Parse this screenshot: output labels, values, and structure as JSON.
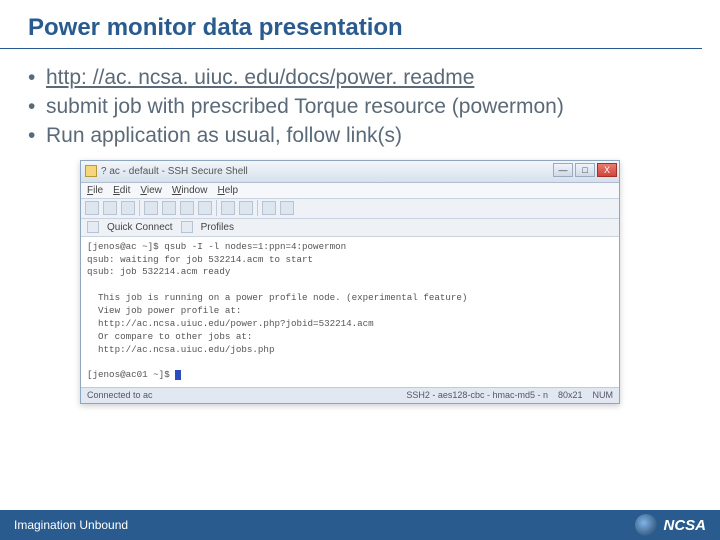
{
  "title": "Power monitor data presentation",
  "bullets": {
    "b1_link": "http: //ac. ncsa. uiuc. edu/docs/power. readme",
    "b2": "submit job with prescribed Torque resource (powermon)",
    "b3": "Run application as usual, follow link(s)"
  },
  "window": {
    "title": "? ac - default - SSH Secure Shell",
    "menu": {
      "file": "File",
      "edit": "Edit",
      "view": "View",
      "window": "Window",
      "help": "Help"
    },
    "quick": {
      "connect": "Quick Connect",
      "profiles": "Profiles"
    },
    "winbtn": {
      "min": "—",
      "max": "□",
      "close": "X"
    },
    "terminal_text": "[jenos@ac ~]$ qsub -I -l nodes=1:ppn=4:powermon\nqsub: waiting for job 532214.acm to start\nqsub: job 532214.acm ready\n\n  This job is running on a power profile node. (experimental feature)\n  View job power profile at:\n  http://ac.ncsa.uiuc.edu/power.php?jobid=532214.acm\n  Or compare to other jobs at:\n  http://ac.ncsa.uiuc.edu/jobs.php\n\n[jenos@ac01 ~]$ ",
    "status": {
      "left": "Connected to ac",
      "ssh": "SSH2 - aes128-cbc - hmac-md5 - n",
      "size": "80x21",
      "num": "NUM"
    }
  },
  "footer": {
    "tagline": "Imagination Unbound",
    "logo": "NCSA"
  }
}
